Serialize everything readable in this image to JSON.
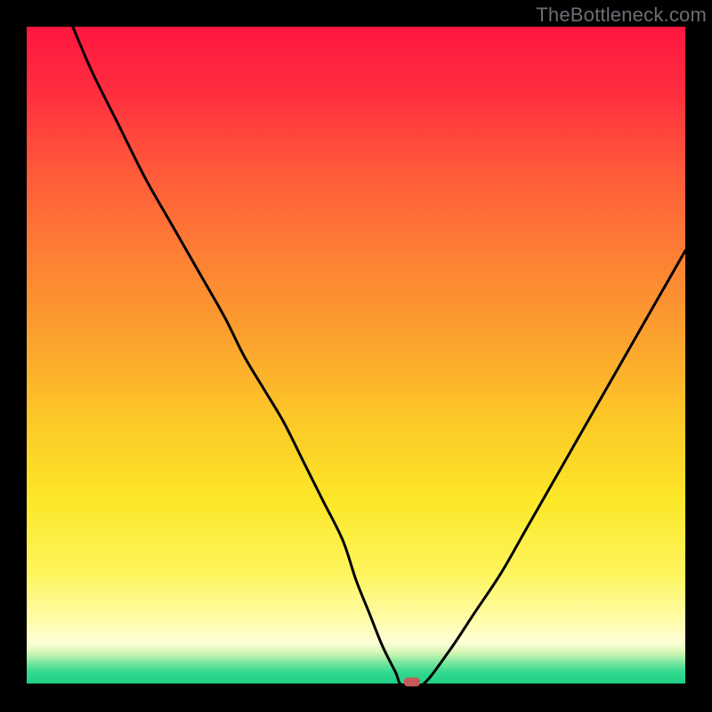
{
  "watermark": "TheBottleneck.com",
  "chart_data": {
    "type": "line",
    "title": "",
    "xlabel": "",
    "ylabel": "",
    "xlim": [
      0,
      100
    ],
    "ylim": [
      0,
      100
    ],
    "series": [
      {
        "name": "bottleneck-curve",
        "x": [
          7,
          10,
          14,
          18,
          22,
          26,
          30,
          33,
          36,
          39,
          42,
          45,
          48,
          50,
          52,
          54,
          56,
          57,
          60,
          64,
          68,
          72,
          76,
          80,
          84,
          88,
          92,
          96,
          100
        ],
        "values": [
          100,
          93,
          85,
          77,
          70,
          63,
          56,
          50,
          45,
          40,
          34,
          28,
          22,
          16,
          11,
          6,
          2,
          0,
          0,
          5,
          11,
          17,
          24,
          31,
          38,
          45,
          52,
          59,
          66
        ]
      }
    ],
    "marker": {
      "x": 58.5,
      "y": 0.5,
      "color": "#c55a5a"
    },
    "background_gradient": {
      "type": "vertical",
      "stops": [
        {
          "pos": 0,
          "color": "#ff163f"
        },
        {
          "pos": 50,
          "color": "#fcc927"
        },
        {
          "pos": 90,
          "color": "#fffca8"
        },
        {
          "pos": 100,
          "color": "#1ecf84"
        }
      ]
    }
  }
}
